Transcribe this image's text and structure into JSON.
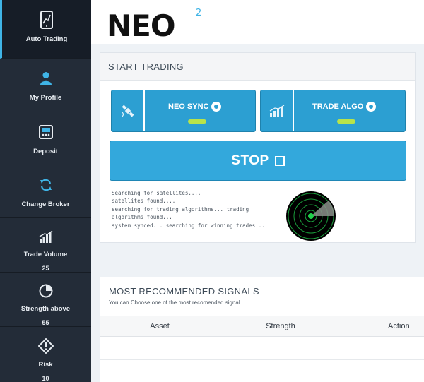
{
  "sidebar": {
    "items": [
      {
        "label": "Auto Trading",
        "icon": "auto-trading-icon",
        "active": true
      },
      {
        "label": "My Profile",
        "icon": "user-icon"
      },
      {
        "label": "Deposit",
        "icon": "deposit-icon"
      },
      {
        "label": "Change Broker",
        "icon": "refresh-icon"
      },
      {
        "label": "Trade Volume",
        "icon": "volume-chart-icon",
        "value": "25"
      },
      {
        "label": "Strength above",
        "icon": "pie-icon",
        "value": "55"
      },
      {
        "label": "Risk",
        "icon": "warning-icon",
        "value": "10"
      }
    ]
  },
  "header": {
    "logo_text": "NEO",
    "logo_sup": "2"
  },
  "trading": {
    "title": "START TRADING",
    "neo_sync_label": "NEO SYNC",
    "trade_algo_label": "TRADE ALGO",
    "stop_label": "STOP",
    "log_lines": [
      "Searching for satellites....",
      "satellites found....",
      "searching for trading algorithms... trading",
      "algorithms found...",
      "system synced... searching for winning trades..."
    ]
  },
  "signals": {
    "title": "MOST RECOMMENDED SIGNALS",
    "subtitle": "You can Choose one of the most recomended signal",
    "columns": [
      "Asset",
      "Strength",
      "Action"
    ]
  },
  "colors": {
    "sidebar_bg": "#232c38",
    "accent_blue": "#2c9fd2",
    "led_green": "#b8e34a",
    "radar_green": "#1fd14a"
  }
}
